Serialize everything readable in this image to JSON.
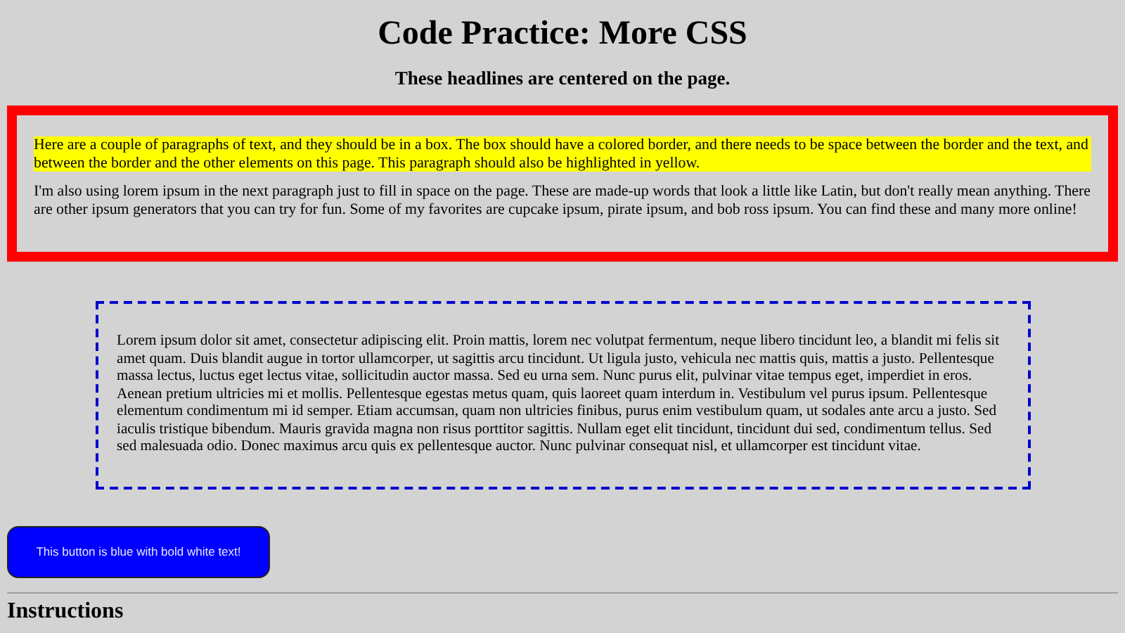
{
  "title": "Code Practice: More CSS",
  "subtitle": "These headlines are centered on the page.",
  "red_box": {
    "paragraphs": [
      {
        "text": "Here are a couple of paragraphs of text, and they should be in a box. The box should have a colored border, and there needs to be space between the border and the text, and between the border and the other elements on this page. This paragraph should also be highlighted in yellow.",
        "highlighted": true
      },
      {
        "text": "I'm also using lorem ipsum in the next paragraph just to fill in space on the page. These are made-up words that look a little like Latin, but don't really mean anything. There are other ipsum generators that you can try for fun. Some of my favorites are cupcake ipsum, pirate ipsum, and bob ross ipsum. You can find these and many more online!",
        "highlighted": false
      }
    ]
  },
  "dashed_box": {
    "text": "Lorem ipsum dolor sit amet, consectetur adipiscing elit. Proin mattis, lorem nec volutpat fermentum, neque libero tincidunt leo, a blandit mi felis sit amet quam. Duis blandit augue in tortor ullamcorper, ut sagittis arcu tincidunt. Ut ligula justo, vehicula nec mattis quis, mattis a justo. Pellentesque massa lectus, luctus eget lectus vitae, sollicitudin auctor massa. Sed eu urna sem. Nunc purus elit, pulvinar vitae tempus eget, imperdiet in eros. Aenean pretium ultricies mi et mollis. Pellentesque egestas metus quam, quis laoreet quam interdum in. Vestibulum vel purus ipsum. Pellentesque elementum condimentum mi id semper. Etiam accumsan, quam non ultricies finibus, purus enim vestibulum quam, ut sodales ante arcu a justo. Sed iaculis tristique bibendum. Mauris gravida magna non risus porttitor sagittis. Nullam eget elit tincidunt, tincidunt dui sed, condimentum tellus. Sed sed malesuada odio. Donec maximus arcu quis ex pellentesque auctor. Nunc pulvinar consequat nisl, et ullamcorper est tincidunt vitae."
  },
  "button": {
    "label": "This button is blue with bold white text!"
  },
  "section_heading": "Instructions"
}
